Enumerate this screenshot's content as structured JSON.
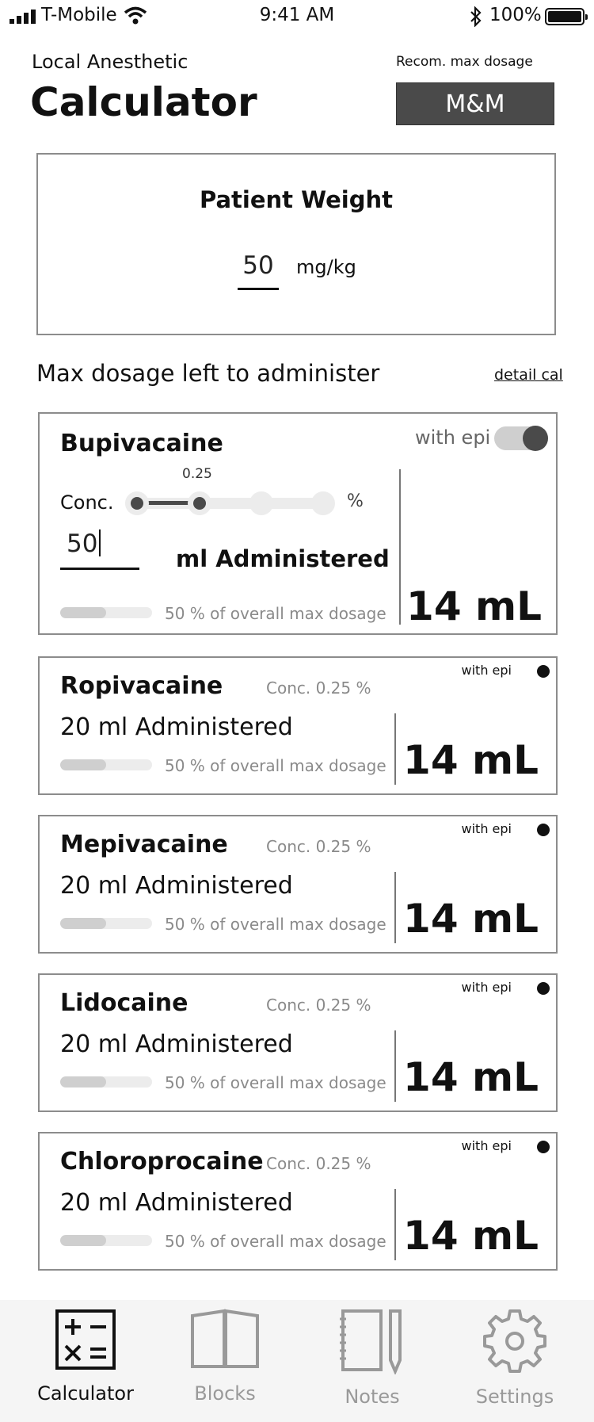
{
  "status_bar": {
    "carrier": "T-Mobile",
    "time": "9:41 AM",
    "battery": "100%"
  },
  "header": {
    "subtitle": "Local Anesthetic",
    "title": "Calculator",
    "recom_label": "Recom. max dosage",
    "recom_button": "M&M"
  },
  "patient_weight": {
    "label": "Patient Weight",
    "value": "50",
    "unit": "mg/kg"
  },
  "section": {
    "title": "Max dosage left to administer",
    "detail_link": "detail cal"
  },
  "expanded": {
    "name": "Bupivacaine",
    "epi_label": "with epi",
    "epi_on": true,
    "conc_label": "Conc.",
    "slider_value": "0.25",
    "slider_unit": "%",
    "administered_value": "50",
    "administered_label": "ml Administered",
    "percent_label": "50 % of overall max dosage",
    "percent_fill": 0.5,
    "result": "14 mL"
  },
  "drugs": [
    {
      "name": "Ropivacaine",
      "conc": "Conc. 0.25 %",
      "administered": "20 ml Administered",
      "percent_label": "50 % of overall max dosage",
      "percent_fill": 0.5,
      "result": "14 mL",
      "epi_label": "with epi"
    },
    {
      "name": "Mepivacaine",
      "conc": "Conc. 0.25 %",
      "administered": "20 ml Administered",
      "percent_label": "50 % of overall max dosage",
      "percent_fill": 0.5,
      "result": "14 mL",
      "epi_label": "with epi"
    },
    {
      "name": "Lidocaine",
      "conc": "Conc. 0.25 %",
      "administered": "20 ml Administered",
      "percent_label": "50 % of overall max dosage",
      "percent_fill": 0.5,
      "result": "14 mL",
      "epi_label": "with epi"
    },
    {
      "name": "Chloroprocaine",
      "conc": "Conc. 0.25 %",
      "administered": "20 ml Administered",
      "percent_label": "50 % of overall max dosage",
      "percent_fill": 0.5,
      "result": "14 mL",
      "epi_label": "with epi"
    }
  ],
  "tabs": [
    {
      "label": "Calculator",
      "icon": "calculator-icon",
      "active": true
    },
    {
      "label": "Blocks",
      "icon": "book-icon",
      "active": false
    },
    {
      "label": "Notes",
      "icon": "notebook-pencil-icon",
      "active": false
    },
    {
      "label": "Settings",
      "icon": "gear-icon",
      "active": false
    }
  ],
  "colors": {
    "accent_dark": "#4a4a4a",
    "border": "#8c8c8c",
    "muted_text": "#8a8a8a",
    "inactive_tab": "#999999"
  }
}
